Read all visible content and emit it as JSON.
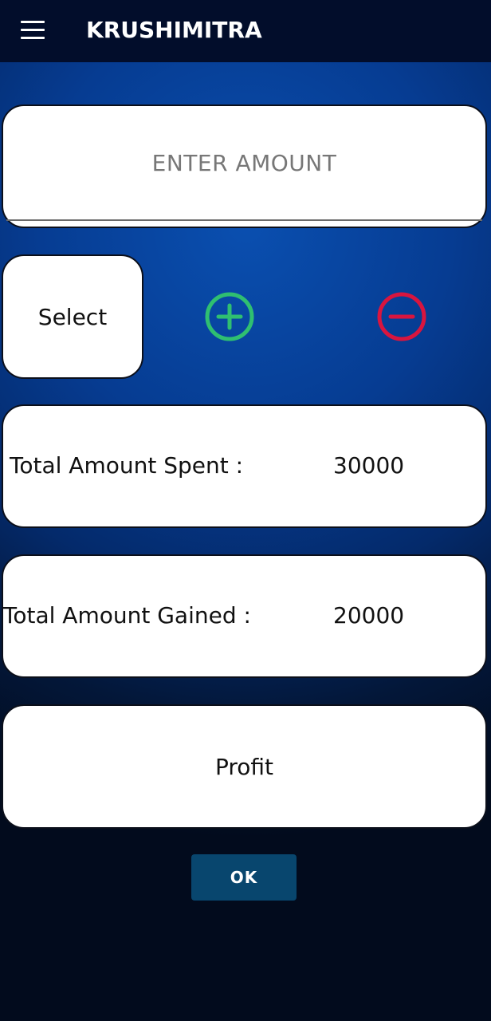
{
  "appbar": {
    "title": "KRUSHIMITRA",
    "menu_icon": "menu-icon"
  },
  "amount_field": {
    "placeholder": "ENTER AMOUNT",
    "value": ""
  },
  "select": {
    "label": "Select"
  },
  "actions": {
    "add_icon": "plus-circle-icon",
    "add_color": "#2fbf71",
    "remove_icon": "minus-circle-icon",
    "remove_color": "#d8153f"
  },
  "totals": {
    "spent_label": "Total Amount Spent :",
    "spent_value": "30000",
    "gained_label": "Total Amount Gained :",
    "gained_value": "20000"
  },
  "profit": {
    "label": "Profit"
  },
  "ok_button": {
    "label": "OK"
  },
  "colors": {
    "appbar_bg": "#020d2b",
    "background_accent": "#0a4fb0",
    "ok_button_bg": "#08466e"
  }
}
